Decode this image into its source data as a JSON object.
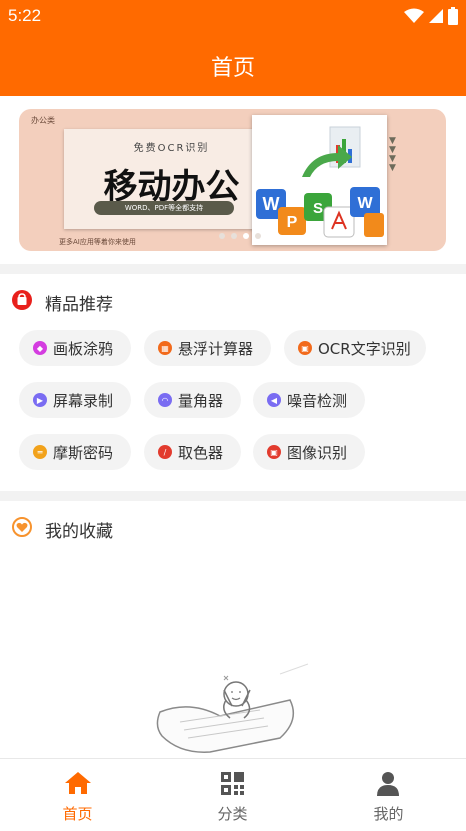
{
  "status_bar": {
    "time": "5:22"
  },
  "app_bar": {
    "title": "首页"
  },
  "banner": {
    "corner_label": "办公类",
    "subtitle": "免费OCR识别",
    "headline": "移动办公",
    "pill_text": "WORD、PDF等全都支持",
    "footer_text": "更多AI应用等着你来使用",
    "active_dot": 3
  },
  "recommend": {
    "title": "精品推荐",
    "items": [
      {
        "label": "画板涂鸦",
        "color": "#d43de0"
      },
      {
        "label": "悬浮计算器",
        "color": "#f26a1b"
      },
      {
        "label": "OCR文字识别",
        "color": "#f26a1b"
      },
      {
        "label": "屏幕录制",
        "color": "#7a6cf2"
      },
      {
        "label": "量角器",
        "color": "#7a6cf2"
      },
      {
        "label": "噪音检测",
        "color": "#7a6cf2"
      },
      {
        "label": "摩斯密码",
        "color": "#f2a21b"
      },
      {
        "label": "取色器",
        "color": "#e23b2e"
      },
      {
        "label": "图像识别",
        "color": "#e23b2e"
      }
    ]
  },
  "favorites": {
    "title": "我的收藏"
  },
  "bottom_nav": [
    {
      "label": "首页",
      "active": true
    },
    {
      "label": "分类",
      "active": false
    },
    {
      "label": "我的",
      "active": false
    }
  ],
  "colors": {
    "brand": "#ff6a00",
    "nav_inactive": "#666666",
    "recommend_icon": "#e8201c",
    "favorites_icon": "#f7932e"
  }
}
